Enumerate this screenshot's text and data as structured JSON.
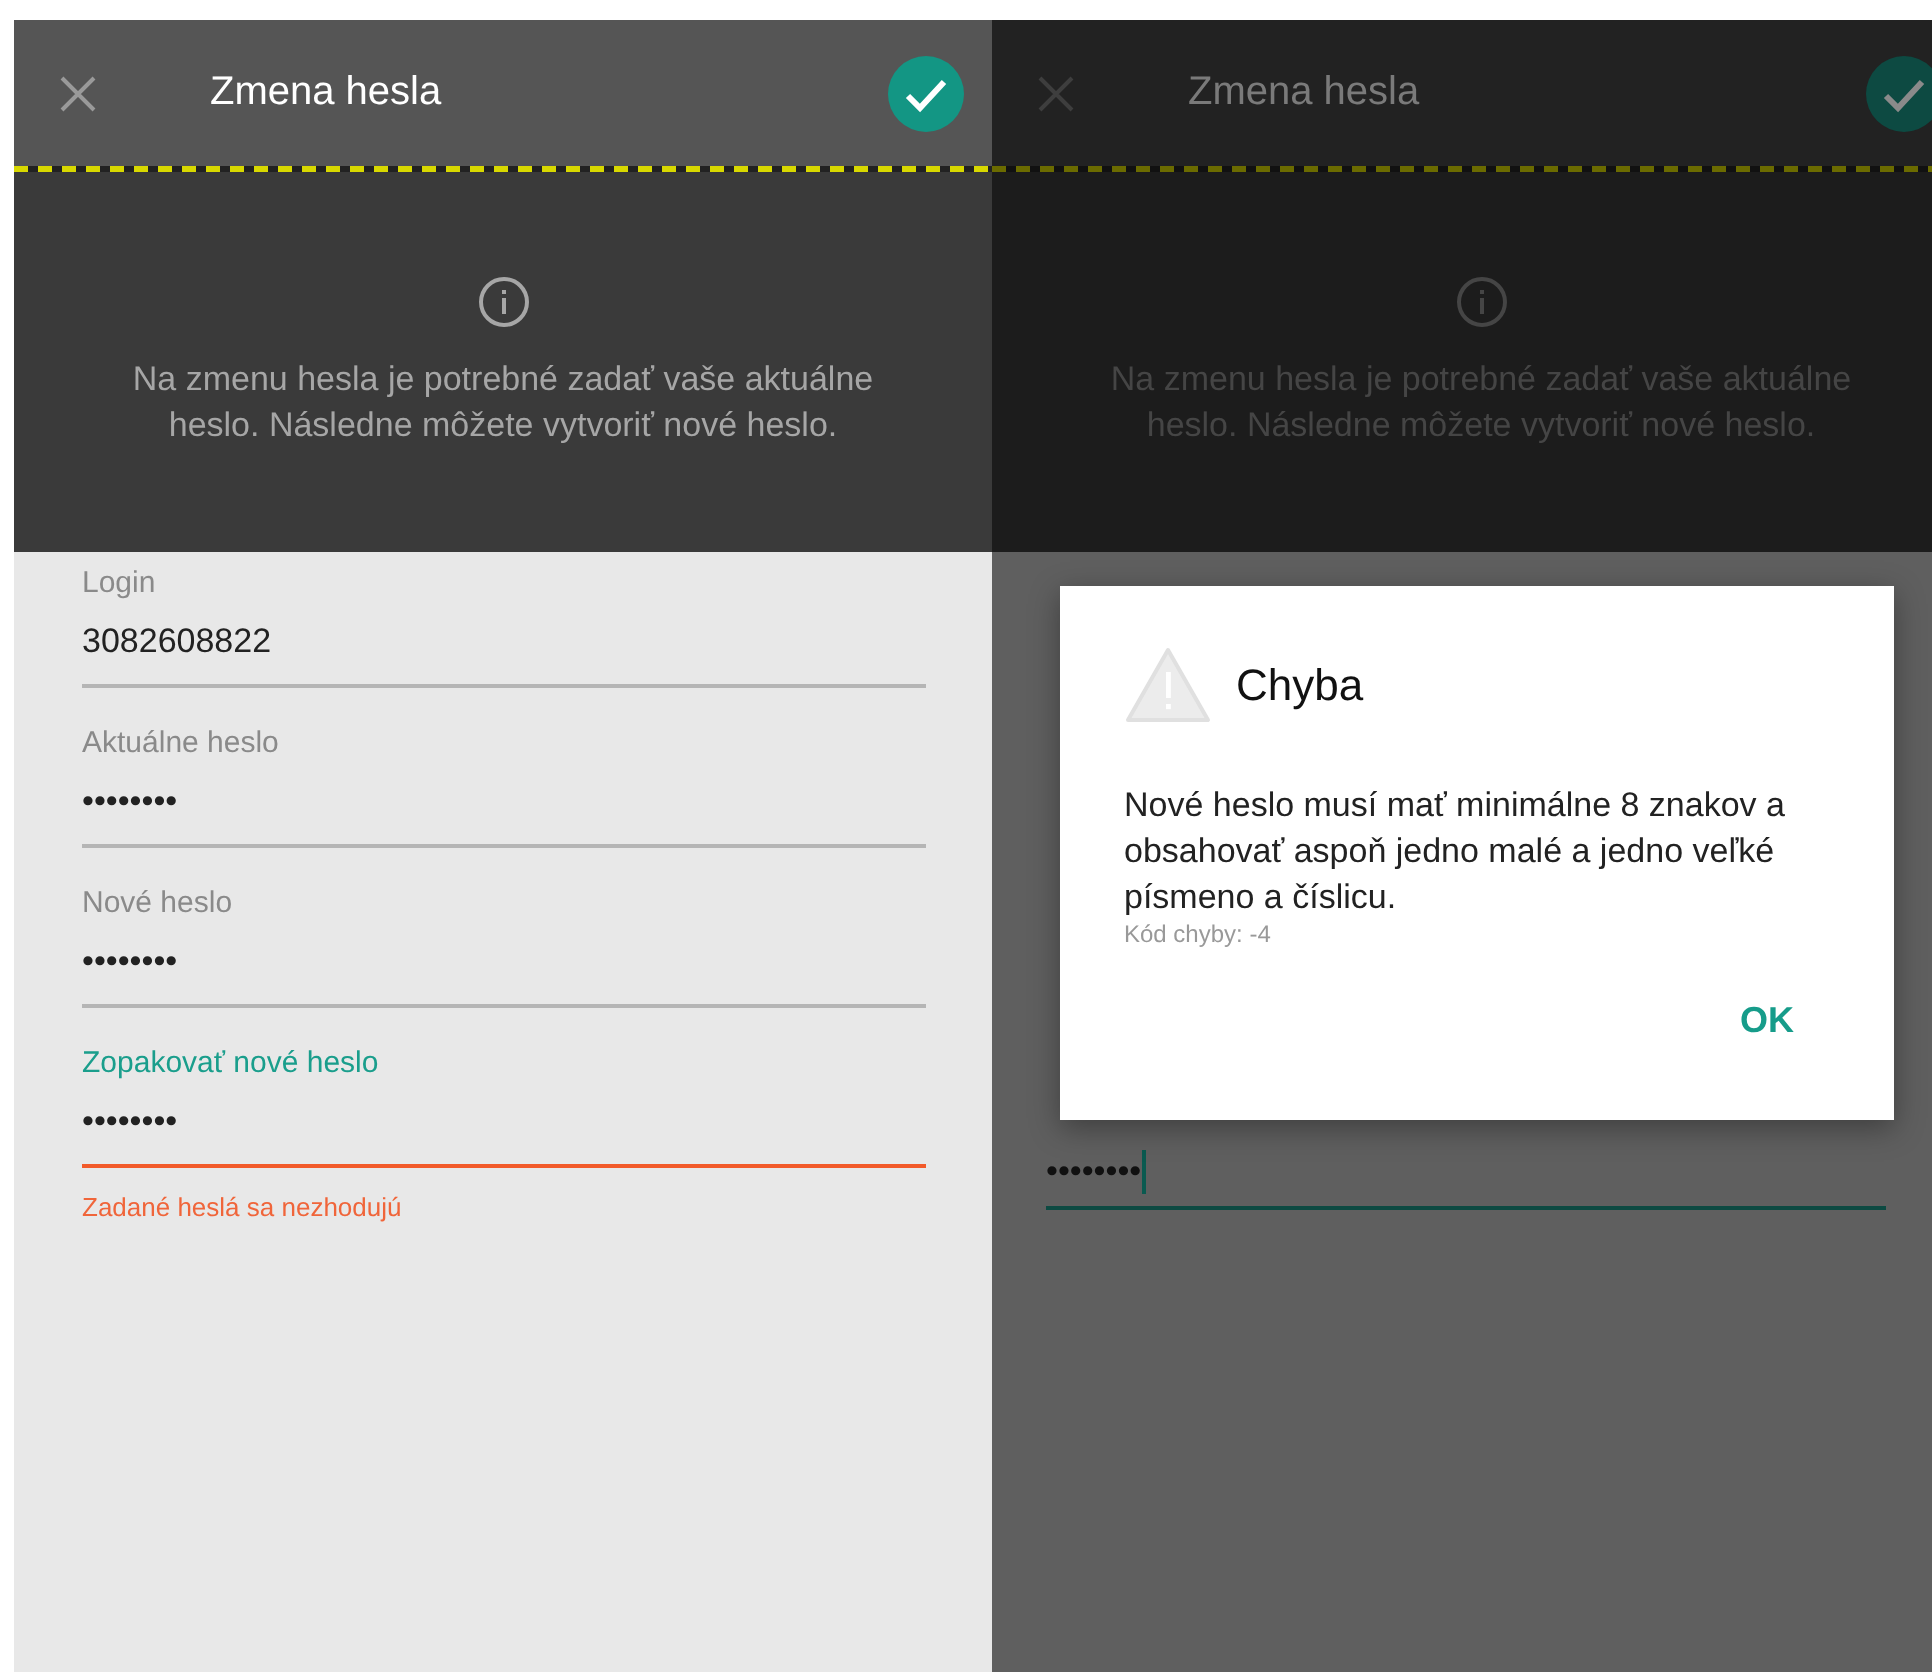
{
  "screens": [
    {
      "dimmed": false,
      "toolbar": {
        "title": "Zmena hesla"
      },
      "info": "Na zmenu hesla je potrebné zadať vaše aktuálne heslo. Následne môžete vytvoriť nové heslo.",
      "fields": [
        {
          "label": "Login",
          "value": "3082608822",
          "focused": false,
          "error": false
        },
        {
          "label": "Aktuálne heslo",
          "value": "••••••••",
          "focused": false,
          "error": false
        },
        {
          "label": "Nové heslo",
          "value": "••••••••",
          "focused": false,
          "error": false
        },
        {
          "label": "Zopakovať nové heslo",
          "value": "••••••••",
          "focused": true,
          "error": true,
          "error_message": "Zadané heslá sa nezhodujú"
        }
      ]
    },
    {
      "dimmed": true,
      "toolbar": {
        "title": "Zmena hesla"
      },
      "info": "Na zmenu hesla je potrebné zadať vaše aktuálne heslo. Následne môžete vytvoriť nové heslo.",
      "fields": [
        {
          "value": "••••••••",
          "focused": true,
          "error": false
        }
      ],
      "dialog": {
        "title": "Chyba",
        "message": "Nové heslo musí mať minimálne 8 znakov a obsahovať aspoň jedno malé a jedno veľké písmeno a číslicu.",
        "code": "Kód chyby:  -4",
        "button": "OK"
      }
    }
  ]
}
